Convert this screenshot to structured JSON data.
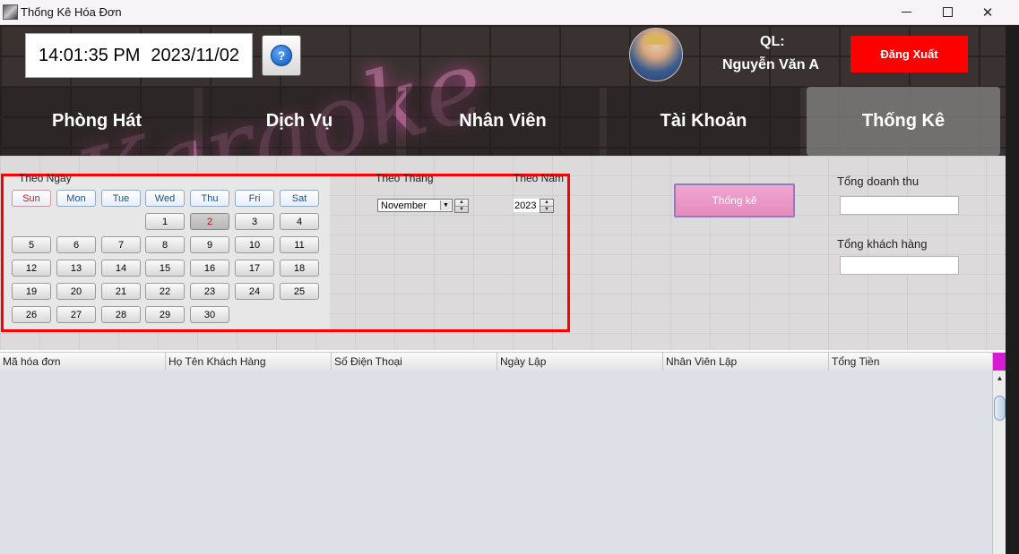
{
  "window": {
    "title": "Thống Kê Hóa Đơn",
    "controls": {
      "minimize": "—",
      "maximize": "☐",
      "close": "✕"
    }
  },
  "header": {
    "time": "14:01:35 PM",
    "date": "2023/11/02",
    "help_icon": "?",
    "background_text": "Karaoke",
    "manager_label": "QL:",
    "manager_name": "Nguyễn Văn A",
    "logout_label": "Đăng Xuất",
    "logout_color": "#ff0000"
  },
  "nav": {
    "items": [
      {
        "label": "Phòng Hát"
      },
      {
        "label": "Dịch Vụ"
      },
      {
        "label": "Nhân Viên"
      },
      {
        "label": "Tài Khoản"
      },
      {
        "label": "Thống Kê",
        "active": true
      }
    ]
  },
  "filters": {
    "by_day_label": "Theo Ngày",
    "by_month_label": "Theo Tháng",
    "by_year_label": "Theo Năm",
    "weekdays": [
      "Sun",
      "Mon",
      "Tue",
      "Wed",
      "Thu",
      "Fri",
      "Sat"
    ],
    "days": [
      "1",
      "2",
      "3",
      "4",
      "5",
      "6",
      "7",
      "8",
      "9",
      "10",
      "11",
      "12",
      "13",
      "14",
      "15",
      "16",
      "17",
      "18",
      "19",
      "20",
      "21",
      "22",
      "23",
      "24",
      "25",
      "26",
      "27",
      "28",
      "29",
      "30"
    ],
    "first_weekday_index": 3,
    "selected_day": "2",
    "month_value": "November",
    "year_value": "2023",
    "stat_button_label": "Thống kê"
  },
  "totals": {
    "revenue_label": "Tổng doanh thu",
    "revenue_value": "",
    "customers_label": "Tổng khách hàng",
    "customers_value": ""
  },
  "table": {
    "columns": [
      "Mã hóa đơn",
      "Họ Tên Khách Hàng",
      "Số Điện Thoại",
      "Ngày Lập",
      "Nhân Viên Lập",
      "Tổng Tiền"
    ],
    "rows": []
  }
}
